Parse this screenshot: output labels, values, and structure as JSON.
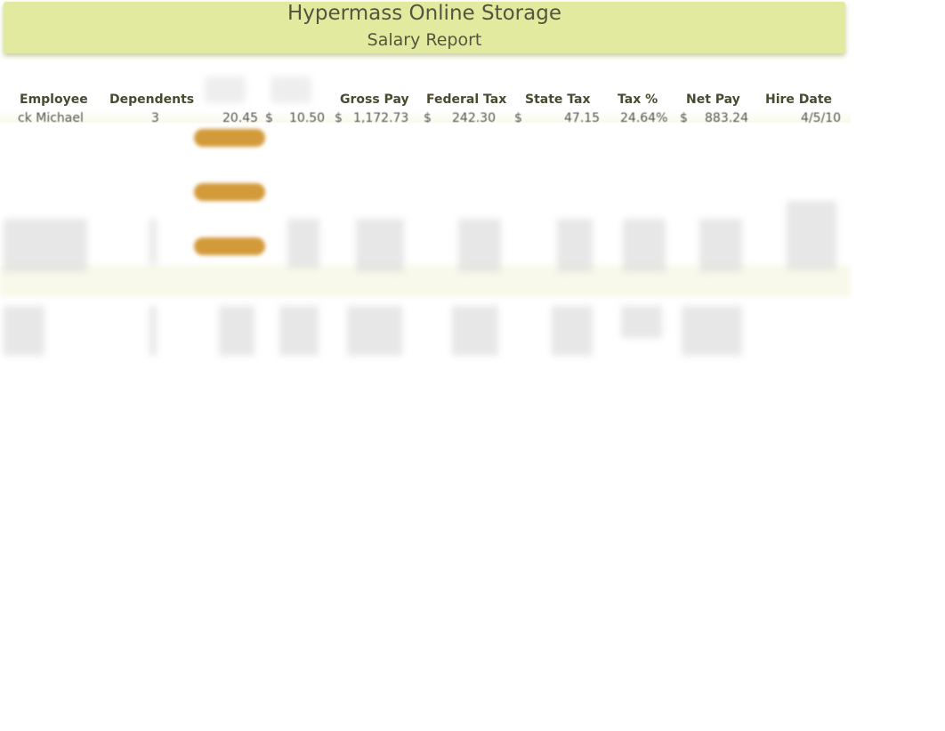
{
  "report": {
    "title": "Hypermass Online Storage",
    "subtitle": "Salary Report"
  },
  "columns": [
    "Employee",
    "Dependents",
    "Gross Pay",
    "Federal Tax",
    "State Tax",
    "Tax %",
    "Net Pay",
    "Hire Date"
  ],
  "first_row": [
    "ck Michael",
    "3",
    "20.45",
    "$",
    "10.50",
    "$",
    "1,172.73",
    "$",
    "242.30",
    "$",
    "47.15",
    "24.64%",
    "$",
    "883.24",
    "4/5/10"
  ],
  "colors": {
    "banner": "#e1ea9f",
    "button": "#d39a3a"
  }
}
